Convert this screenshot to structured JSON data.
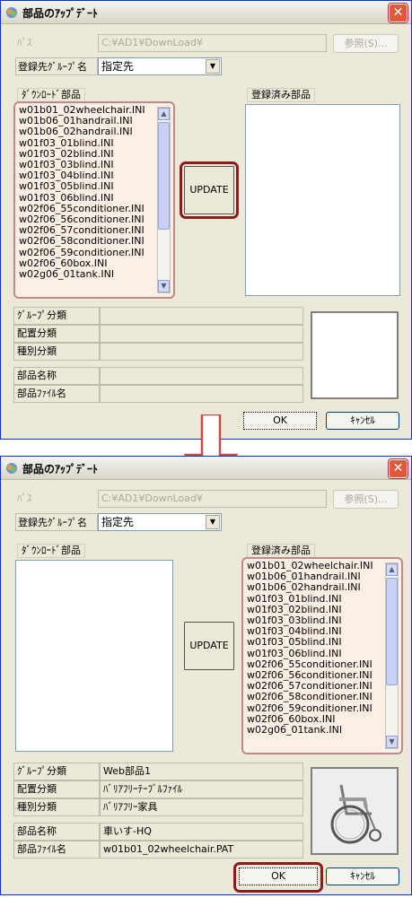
{
  "dialog": {
    "title": "部品のｱｯﾌﾟﾃﾞｰﾄ",
    "path_label": "ﾊﾟｽ",
    "path_value": "C:¥AD1¥DownLoad¥",
    "browse_button": "参照(S)...",
    "group_label": "登録先ｸﾞﾙｰﾌﾟ名",
    "group_value": "指定先",
    "download_caption": "ﾀﾞｳﾝﾛｰﾄﾞ部品",
    "registered_caption": "登録済み部品",
    "update_button": "UPDATE",
    "info_labels": {
      "group_class": "ｸﾞﾙｰﾌﾟ分類",
      "place_class": "配置分類",
      "kind_class": "種別分類",
      "part_name": "部品名称",
      "part_file": "部品ﾌｧｲﾙ名"
    },
    "ok_button": "OK",
    "cancel_button": "ｷｬﾝｾﾙ"
  },
  "items": [
    "w01b01_02wheelchair.INI",
    "w01b06_01handrail.INI",
    "w01b06_02handrail.INI",
    "w01f03_01blind.INI",
    "w01f03_02blind.INI",
    "w01f03_03blind.INI",
    "w01f03_04blind.INI",
    "w01f03_05blind.INI",
    "w01f03_06blind.INI",
    "w02f06_55conditioner.INI",
    "w02f06_56conditioner.INI",
    "w02f06_57conditioner.INI",
    "w02f06_58conditioner.INI",
    "w02f06_59conditioner.INI",
    "w02f06_60box.INI",
    "w02g06_01tank.INI"
  ],
  "after_info": {
    "group_class": "Web部品1",
    "place_class": "ﾊﾞﾘｱﾌﾘｰﾃｰﾌﾞﾙﾌｧｲﾙ",
    "kind_class": "ﾊﾞﾘｱﾌﾘｰ家具",
    "part_name": "車いす-HQ",
    "part_file": "w01b01_02wheelchair.PAT"
  },
  "colors": {
    "highlight_ring": "#8b1a1a",
    "list_highlight": "#fcefe6",
    "arrow": "#c0504d"
  },
  "icons": [
    "app-icon",
    "close-icon",
    "dropdown-arrow-icon",
    "scroll-up-icon",
    "scroll-down-icon",
    "flow-arrow-icon",
    "wheelchair-image"
  ]
}
